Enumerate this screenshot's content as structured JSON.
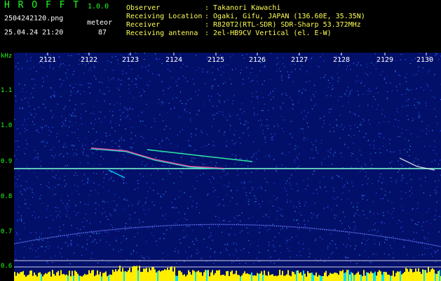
{
  "app": {
    "title": "H R O F F T",
    "version": "1.0.0",
    "filename": "2504242120.png",
    "datetime": "25.04.24 21:20",
    "meteor_label": "meteor",
    "meteor_count": "87"
  },
  "info": [
    {
      "label": "Observer",
      "value": ": Takanori Kawachi"
    },
    {
      "label": "Receiving Location",
      "value": ": Ogaki, Gifu, JAPAN (136.60E, 35.35N)"
    },
    {
      "label": "Receiver",
      "value": ": R820T2(RTL-SDR) SDR-Sharp 53.372MHz"
    },
    {
      "label": "Receiving antenna",
      "value": ": 2el-HB9CV Vertical (el. E-W)"
    }
  ],
  "axis": {
    "y_unit": "kHz",
    "y_ticks": [
      "1.1",
      "1.0",
      "0.9",
      "0.8",
      "0.7",
      "0.6"
    ],
    "x_ticks": [
      "2121",
      "2122",
      "2123",
      "2124",
      "2125",
      "2126",
      "2127",
      "2128",
      "2129",
      "2130"
    ]
  },
  "colors": {
    "background": "#000000",
    "plot_bg": "#03106a",
    "header_green": "#22ff22",
    "header_yellow": "#ffff55",
    "signal_line": "#7fffd4",
    "spectrum_bar": "#ffee00"
  }
}
